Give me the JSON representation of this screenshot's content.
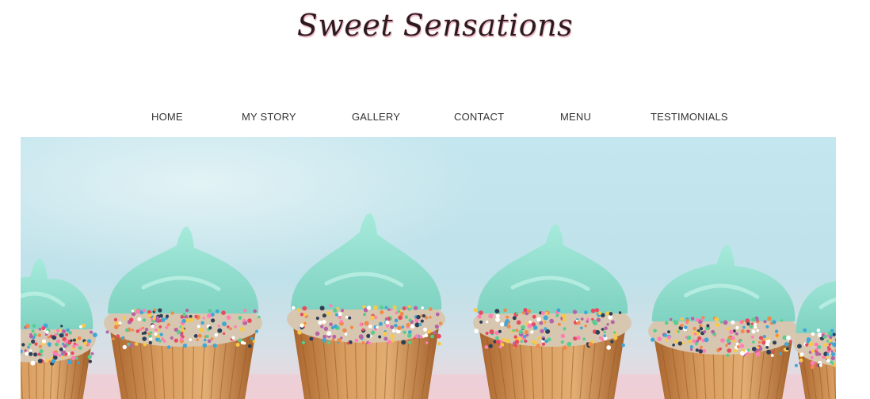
{
  "site": {
    "logo_text": "Sweet Sensations",
    "brand_color": "#2b1b1e",
    "logo_shadow_color": "#f3b8c6"
  },
  "nav": {
    "items": [
      {
        "label": "HOME"
      },
      {
        "label": "MY STORY"
      },
      {
        "label": "GALLERY"
      },
      {
        "label": "CONTACT"
      },
      {
        "label": "MENU"
      },
      {
        "label": "TESTIMONIALS"
      }
    ]
  },
  "hero": {
    "subject": "row of cupcakes with mint frosting and rainbow sprinkles",
    "sky_color": "#bfe3ea",
    "frosting_color": "#8fe0cf",
    "cake_color": "#c9844a",
    "surface_color": "#f1d3da"
  }
}
